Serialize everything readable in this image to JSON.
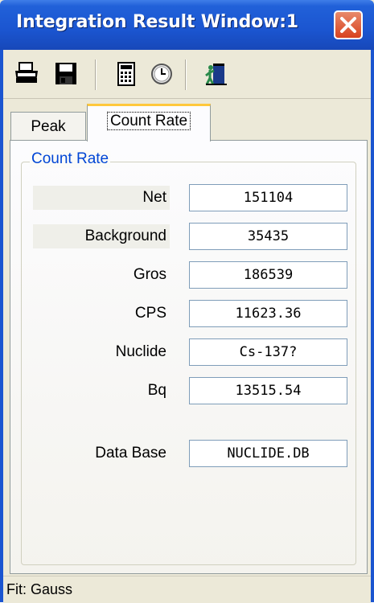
{
  "window": {
    "title": "Integration Result Window:1"
  },
  "toolbar": {
    "buttons": [
      {
        "icon": "printer-icon"
      },
      {
        "icon": "save-icon"
      },
      {
        "icon": "calculator-icon"
      },
      {
        "icon": "clock-icon"
      },
      {
        "icon": "exit-door-icon"
      }
    ]
  },
  "tabs": [
    {
      "label": "Peak",
      "selected": false
    },
    {
      "label": "Count Rate",
      "selected": true
    }
  ],
  "count_rate": {
    "group_title": "Count Rate",
    "rows": [
      {
        "label": "Net",
        "value": "151104"
      },
      {
        "label": "Background",
        "value": "35435"
      },
      {
        "label": "Gros",
        "value": "186539"
      },
      {
        "label": "CPS",
        "value": "11623.36"
      },
      {
        "label": "Nuclide",
        "value": "Cs-137?"
      },
      {
        "label": "Bq",
        "value": "13515.54"
      }
    ],
    "database": {
      "label": "Data Base",
      "value": "NUCLIDE.DB"
    }
  },
  "status": {
    "text": "Fit: Gauss"
  },
  "colors": {
    "titlebar": "#1b55d0",
    "group_title": "#0046d5",
    "close": "#d8421f",
    "active_tab": "#ffc83c"
  }
}
